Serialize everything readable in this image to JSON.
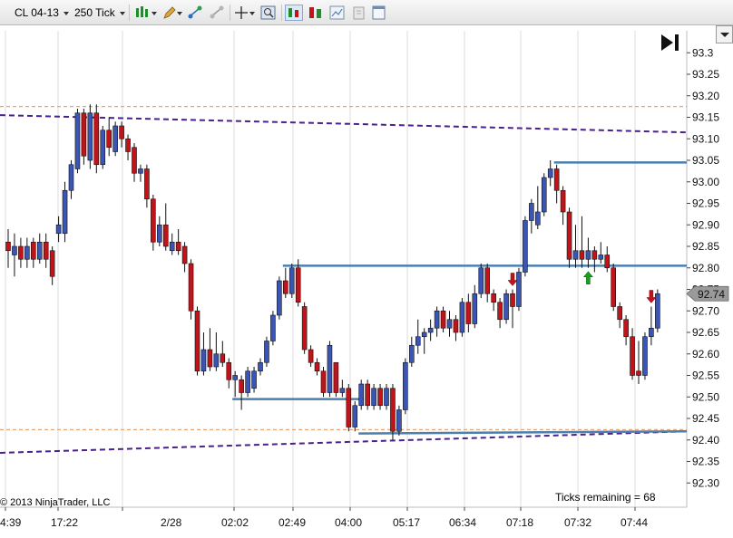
{
  "toolbar": {
    "instrument": "CL 04-13",
    "period": "250 Tick"
  },
  "chart_data": {
    "type": "candlestick",
    "y_axis": {
      "min": 92.28,
      "max": 93.34,
      "tick_step": 0.05,
      "tick_labels": [
        "93.3",
        "93.25",
        "93.20",
        "93.15",
        "93.10",
        "93.05",
        "93.00",
        "92.95",
        "92.90",
        "92.85",
        "92.80",
        "92.75",
        "92.70",
        "92.65",
        "92.60",
        "92.55",
        "92.50",
        "92.45",
        "92.40",
        "92.35",
        "92.30"
      ]
    },
    "x_tick_labels": [
      "4:39",
      "17:22",
      "2/28",
      "02:02",
      "02:49",
      "04:00",
      "05:17",
      "06:34",
      "07:18",
      "07:32",
      "07:44"
    ],
    "candles": [
      [
        92.86,
        92.84,
        92.8,
        92.89
      ],
      [
        92.83,
        92.85,
        92.78,
        92.88
      ],
      [
        92.85,
        92.82,
        92.8,
        92.87
      ],
      [
        92.82,
        92.85,
        92.8,
        92.87
      ],
      [
        92.86,
        92.82,
        92.8,
        92.87
      ],
      [
        92.82,
        92.86,
        92.81,
        92.88
      ],
      [
        92.86,
        92.82,
        92.8,
        92.88
      ],
      [
        92.84,
        92.78,
        92.76,
        92.85
      ],
      [
        92.88,
        92.9,
        92.86,
        92.92
      ],
      [
        92.88,
        92.98,
        92.86,
        93.0
      ],
      [
        92.98,
        93.04,
        92.96,
        93.05
      ],
      [
        93.03,
        93.16,
        93.02,
        93.17
      ],
      [
        93.16,
        93.06,
        93.04,
        93.17
      ],
      [
        93.05,
        93.16,
        93.03,
        93.18
      ],
      [
        93.16,
        93.04,
        93.02,
        93.18
      ],
      [
        93.04,
        93.12,
        93.03,
        93.13
      ],
      [
        93.12,
        93.08,
        93.06,
        93.15
      ],
      [
        93.07,
        93.13,
        93.06,
        93.14
      ],
      [
        93.13,
        93.1,
        93.08,
        93.14
      ],
      [
        93.1,
        93.07,
        93.05,
        93.11
      ],
      [
        93.08,
        93.02,
        93.0,
        93.09
      ],
      [
        93.02,
        93.03,
        93.0,
        93.04
      ],
      [
        93.03,
        92.96,
        92.94,
        93.04
      ],
      [
        92.96,
        92.86,
        92.84,
        92.97
      ],
      [
        92.86,
        92.9,
        92.85,
        92.92
      ],
      [
        92.9,
        92.85,
        92.84,
        92.95
      ],
      [
        92.84,
        92.86,
        92.83,
        92.88
      ],
      [
        92.86,
        92.84,
        92.83,
        92.89
      ],
      [
        92.85,
        92.81,
        92.79,
        92.86
      ],
      [
        92.81,
        92.7,
        92.68,
        92.82
      ],
      [
        92.7,
        92.56,
        92.55,
        92.71
      ],
      [
        92.56,
        92.61,
        92.55,
        92.65
      ],
      [
        92.61,
        92.57,
        92.56,
        92.66
      ],
      [
        92.57,
        92.6,
        92.56,
        92.65
      ],
      [
        92.6,
        92.58,
        92.57,
        92.63
      ],
      [
        92.58,
        92.54,
        92.52,
        92.59
      ],
      [
        92.54,
        92.55,
        92.5,
        92.56
      ],
      [
        92.54,
        92.51,
        92.47,
        92.55
      ],
      [
        92.51,
        92.56,
        92.5,
        92.57
      ],
      [
        92.52,
        92.56,
        92.51,
        92.57
      ],
      [
        92.56,
        92.58,
        92.55,
        92.59
      ],
      [
        92.58,
        92.63,
        92.57,
        92.64
      ],
      [
        92.63,
        92.69,
        92.62,
        92.7
      ],
      [
        92.69,
        92.77,
        92.68,
        92.78
      ],
      [
        92.77,
        92.74,
        92.73,
        92.8
      ],
      [
        92.74,
        92.8,
        92.73,
        92.81
      ],
      [
        92.8,
        92.72,
        92.71,
        92.82
      ],
      [
        92.71,
        92.61,
        92.6,
        92.72
      ],
      [
        92.61,
        92.58,
        92.57,
        92.62
      ],
      [
        92.58,
        92.56,
        92.55,
        92.59
      ],
      [
        92.56,
        92.51,
        92.5,
        92.57
      ],
      [
        92.51,
        92.62,
        92.5,
        92.63
      ],
      [
        92.58,
        92.51,
        92.5,
        92.58
      ],
      [
        92.51,
        92.52,
        92.5,
        92.54
      ],
      [
        92.52,
        92.43,
        92.42,
        92.53
      ],
      [
        92.43,
        92.48,
        92.42,
        92.49
      ],
      [
        92.48,
        92.53,
        92.47,
        92.54
      ],
      [
        92.53,
        92.48,
        92.47,
        92.54
      ],
      [
        92.48,
        92.52,
        92.47,
        92.53
      ],
      [
        92.52,
        92.48,
        92.47,
        92.53
      ],
      [
        92.48,
        92.52,
        92.47,
        92.53
      ],
      [
        92.52,
        92.42,
        92.4,
        92.53
      ],
      [
        92.42,
        92.47,
        92.41,
        92.48
      ],
      [
        92.47,
        92.58,
        92.46,
        92.59
      ],
      [
        92.58,
        92.62,
        92.57,
        92.64
      ],
      [
        92.62,
        92.64,
        92.6,
        92.68
      ],
      [
        92.64,
        92.65,
        92.6,
        92.66
      ],
      [
        92.65,
        92.66,
        92.63,
        92.68
      ],
      [
        92.66,
        92.7,
        92.64,
        92.71
      ],
      [
        92.7,
        92.66,
        92.65,
        92.71
      ],
      [
        92.66,
        92.68,
        92.64,
        92.7
      ],
      [
        92.68,
        92.65,
        92.63,
        92.69
      ],
      [
        92.65,
        92.72,
        92.64,
        92.73
      ],
      [
        92.72,
        92.67,
        92.65,
        92.74
      ],
      [
        92.67,
        92.74,
        92.66,
        92.76
      ],
      [
        92.74,
        92.8,
        92.73,
        92.81
      ],
      [
        92.8,
        92.74,
        92.72,
        92.81
      ],
      [
        92.74,
        92.72,
        92.7,
        92.75
      ],
      [
        92.72,
        92.68,
        92.66,
        92.73
      ],
      [
        92.68,
        92.74,
        92.67,
        92.75
      ],
      [
        92.74,
        92.71,
        92.66,
        92.75
      ],
      [
        92.71,
        92.79,
        92.7,
        92.8
      ],
      [
        92.79,
        92.91,
        92.78,
        92.92
      ],
      [
        92.91,
        92.95,
        92.88,
        92.96
      ],
      [
        92.9,
        92.93,
        92.89,
        92.99
      ],
      [
        92.93,
        93.01,
        92.92,
        93.02
      ],
      [
        93.01,
        93.03,
        92.99,
        93.05
      ],
      [
        93.03,
        92.98,
        92.95,
        93.04
      ],
      [
        92.98,
        92.93,
        92.9,
        92.99
      ],
      [
        92.93,
        92.82,
        92.8,
        92.94
      ],
      [
        92.82,
        92.84,
        92.8,
        92.9
      ],
      [
        92.84,
        92.82,
        92.8,
        92.92
      ],
      [
        92.82,
        92.84,
        92.8,
        92.87
      ],
      [
        92.84,
        92.82,
        92.79,
        92.85
      ],
      [
        92.82,
        92.83,
        92.81,
        92.86
      ],
      [
        92.83,
        92.8,
        92.79,
        92.85
      ],
      [
        92.8,
        92.71,
        92.7,
        92.81
      ],
      [
        92.71,
        92.68,
        92.66,
        92.72
      ],
      [
        92.68,
        92.64,
        92.62,
        92.69
      ],
      [
        92.64,
        92.55,
        92.54,
        92.66
      ],
      [
        92.56,
        92.55,
        92.53,
        92.63
      ],
      [
        92.55,
        92.64,
        92.54,
        92.65
      ],
      [
        92.64,
        92.66,
        92.62,
        92.71
      ],
      [
        92.66,
        92.74,
        92.65,
        92.75
      ]
    ],
    "horizontal_lines": [
      {
        "price": 93.045,
        "from_candle": 87,
        "color": "#4a7fb0"
      },
      {
        "price": 92.805,
        "from_candle": 44,
        "color": "#4a7fb0"
      },
      {
        "price": 92.495,
        "from_candle": 36,
        "to_candle": 56,
        "color": "#4a7fb0"
      },
      {
        "price": 92.415,
        "from_candle": 56,
        "price_end": 92.42,
        "color": "#4a7fb0"
      }
    ],
    "dashed_levels": [
      93.175,
      92.424
    ],
    "trend_lines": [
      {
        "start": 93.155,
        "end": 93.115,
        "color": "#4b1f8c"
      },
      {
        "start": 92.37,
        "end": 92.42,
        "color": "#4b1f8c"
      }
    ],
    "signals": [
      {
        "candle": 80,
        "direction": "down",
        "color": "#c0141b"
      },
      {
        "candle": 92,
        "direction": "up",
        "color": "#16a11b"
      },
      {
        "candle": 102,
        "direction": "down",
        "color": "#c0141b"
      }
    ],
    "last_price": "92.74",
    "copyright": "© 2013 NinjaTrader, LLC",
    "ticks_remaining": "Ticks remaining = 68"
  }
}
